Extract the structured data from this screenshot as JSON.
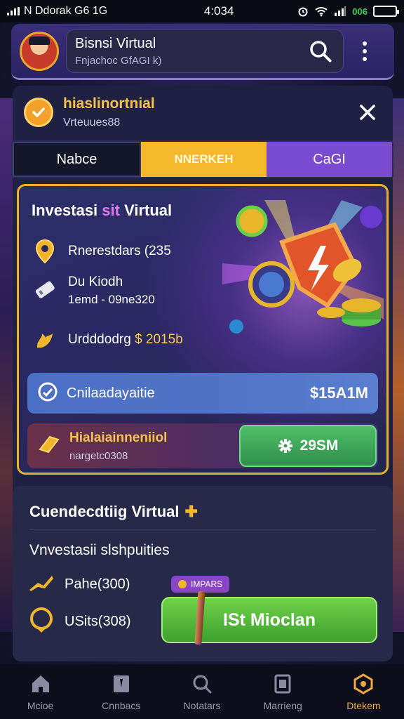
{
  "status_bar": {
    "carrier": "N Ddorak G6 1G",
    "time": "4:034",
    "battery_text": "006"
  },
  "header": {
    "title": "Bisnsi Virtual",
    "subtitle": "Fnjachoc GfAGI k)"
  },
  "notice": {
    "title": "hiaslinortnial",
    "subtitle": "Vrteuues88"
  },
  "tabs": [
    {
      "label": "Nabce"
    },
    {
      "label": "NNERKEH"
    },
    {
      "label": "CaGI"
    }
  ],
  "invest": {
    "title_main": "Investasi ",
    "title_highlight": "sit",
    "title_end": " Virtual",
    "row1": "Rnerestdars (235",
    "row2_title": "Du Kiodh",
    "row2_sub": "1emd - 09ne320",
    "row3_label": "Urdddodrg ",
    "row3_value": "$ 2015b",
    "balance_label": "Cnilaadayaitie",
    "balance_value": "$15A1M",
    "profit_title": "Hialaiainneniiol",
    "profit_sub": "nargetc0308",
    "profit_button": "29SM"
  },
  "lower": {
    "title": "Cuendecdtiig Virtual",
    "subtitle": "Vnvestasii slshpuities",
    "row1": "Pahe(300)",
    "row2": "USits(308)",
    "pill": "IMPARS",
    "cta": "ISt Mioclan"
  },
  "nav": [
    {
      "label": "Mcioe",
      "icon": "home-icon"
    },
    {
      "label": "Cnnbacs",
      "icon": "wallet-icon"
    },
    {
      "label": "Notatars",
      "icon": "search-icon"
    },
    {
      "label": "Marrieng",
      "icon": "document-icon"
    },
    {
      "label": "Dtekem",
      "icon": "hexagon-icon"
    }
  ],
  "colors": {
    "accent_gold": "#f4b82a",
    "accent_purple": "#7a4ad0",
    "success_green": "#3ea12e",
    "panel": "#1e2142"
  }
}
